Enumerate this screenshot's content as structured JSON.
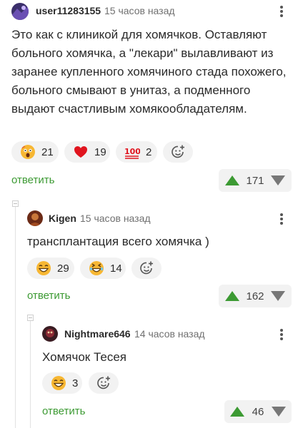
{
  "comments": [
    {
      "username": "user11283155",
      "time": "15 часов назад",
      "text": "Это как с клиникой для хомячков. Оставляют больного хомячка, а \"лекари\" вылавливают из заранее купленного хомячиного стада похожего, больного смывают в унитаз, а подменного выдают счастливым хомякообладателям.",
      "reactions": [
        {
          "icon": "shocked-face-icon",
          "count": "21"
        },
        {
          "icon": "heart-icon",
          "count": "19"
        },
        {
          "icon": "hundred-points-icon",
          "count": "2"
        }
      ],
      "reply_label": "ответить",
      "rating": "171"
    },
    {
      "username": "Kigen",
      "time": "15 часов назад",
      "text": "трансплантация всего хомячка )",
      "reactions": [
        {
          "icon": "grinning-face-icon",
          "count": "29"
        },
        {
          "icon": "laughing-face-icon",
          "count": "14"
        }
      ],
      "reply_label": "ответить",
      "rating": "162"
    },
    {
      "username": "Nightmare646",
      "time": "14 часов назад",
      "text": "Хомячок Тесея",
      "reactions": [
        {
          "icon": "grinning-face-icon",
          "count": "3"
        }
      ],
      "reply_label": "ответить",
      "rating": "46"
    }
  ],
  "colors": {
    "accent": "#3c9a33",
    "pill_bg": "#f2f2f2",
    "muted": "#707070"
  }
}
